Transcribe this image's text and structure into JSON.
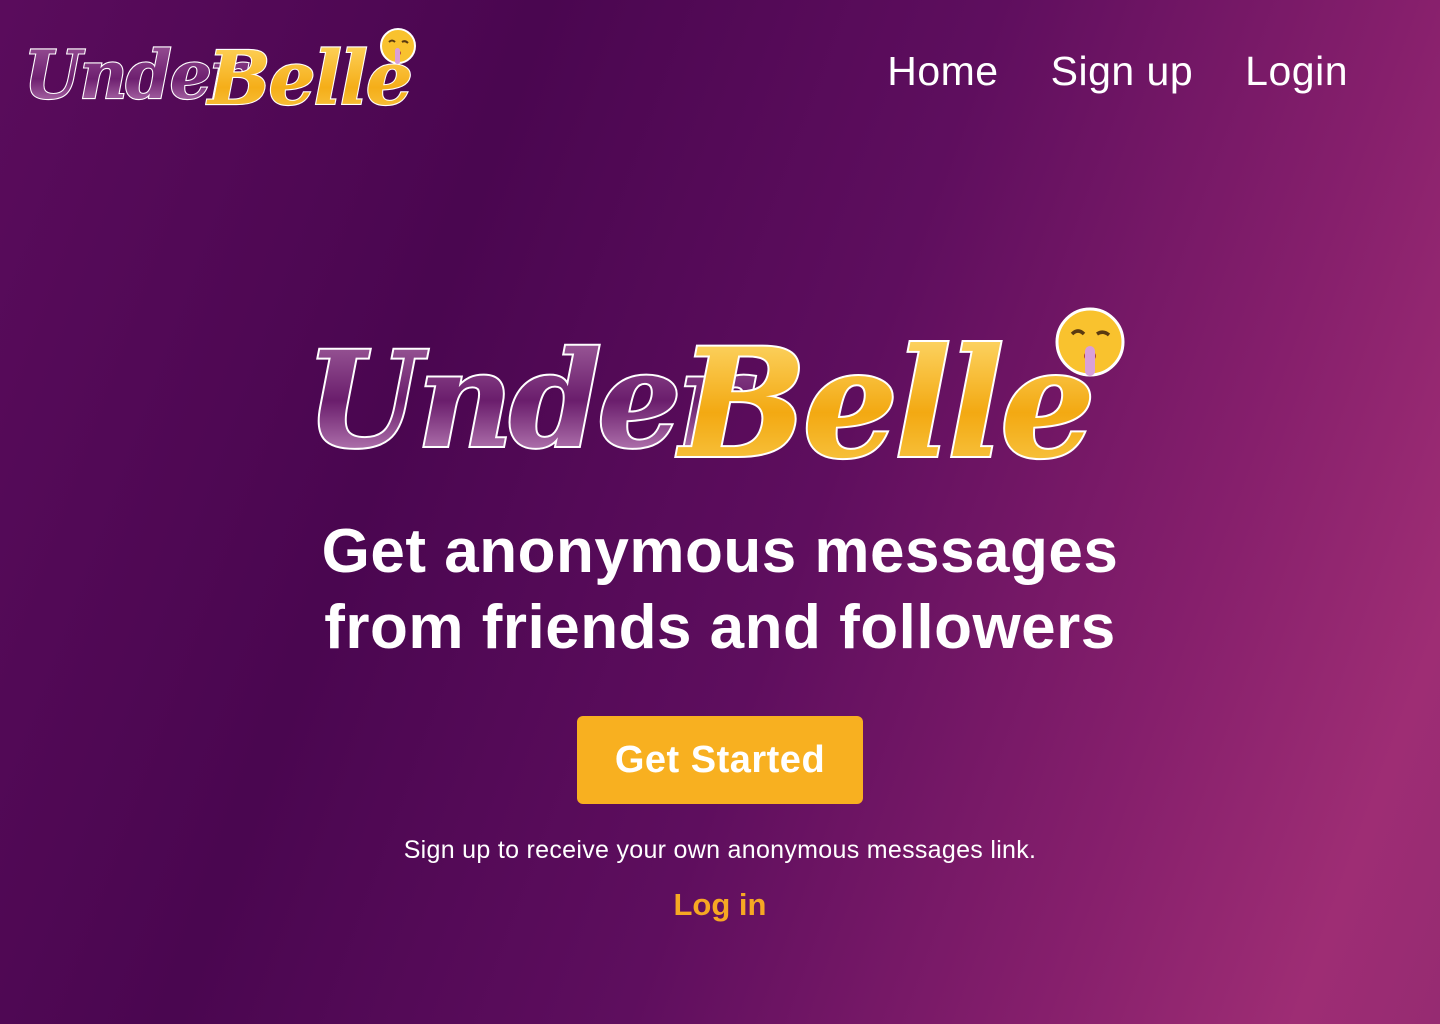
{
  "brand": {
    "logo_part1": "Under",
    "logo_part2": "Belle",
    "logo_emoji": "🤫"
  },
  "nav": {
    "items": [
      {
        "label": "Home"
      },
      {
        "label": "Sign up"
      },
      {
        "label": "Login"
      }
    ]
  },
  "hero": {
    "headline_line1": "Get anonymous messages",
    "headline_line2": "from friends and followers",
    "cta_label": "Get Started",
    "subtext": "Sign up to receive your own anonymous messages link.",
    "login_label": "Log in"
  },
  "colors": {
    "background_start": "#4a0650",
    "background_end": "#9e2d74",
    "accent_yellow": "#f8b020",
    "logo_purple": "#7a2c78",
    "link_orange": "#f6a823"
  }
}
